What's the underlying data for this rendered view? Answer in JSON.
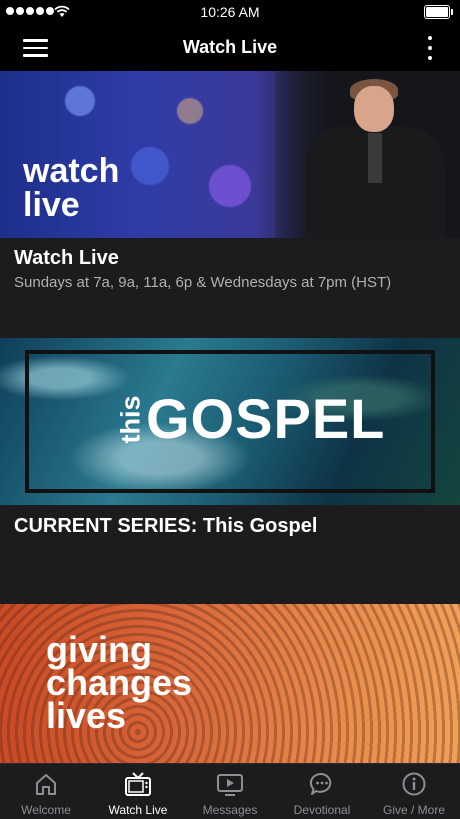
{
  "status_bar": {
    "time": "10:26 AM"
  },
  "header": {
    "title": "Watch Live"
  },
  "cards": [
    {
      "art_text": "watch live",
      "title": "Watch Live",
      "subtitle": "Sundays at 7a, 9a, 11a, 6p & Wednesdays at 7pm (HST)"
    },
    {
      "art_text_small": "this",
      "art_text_large": "GOSPEL",
      "title": "CURRENT SERIES:  This Gospel"
    },
    {
      "art_text": "giving changes lives"
    }
  ],
  "tabs": [
    {
      "label": "Welcome",
      "icon": "home-icon",
      "active": false
    },
    {
      "label": "Watch Live",
      "icon": "tv-icon",
      "active": true
    },
    {
      "label": "Messages",
      "icon": "play-screen-icon",
      "active": false
    },
    {
      "label": "Devotional",
      "icon": "chat-bubble-icon",
      "active": false
    },
    {
      "label": "Give / More",
      "icon": "info-icon",
      "active": false
    }
  ]
}
